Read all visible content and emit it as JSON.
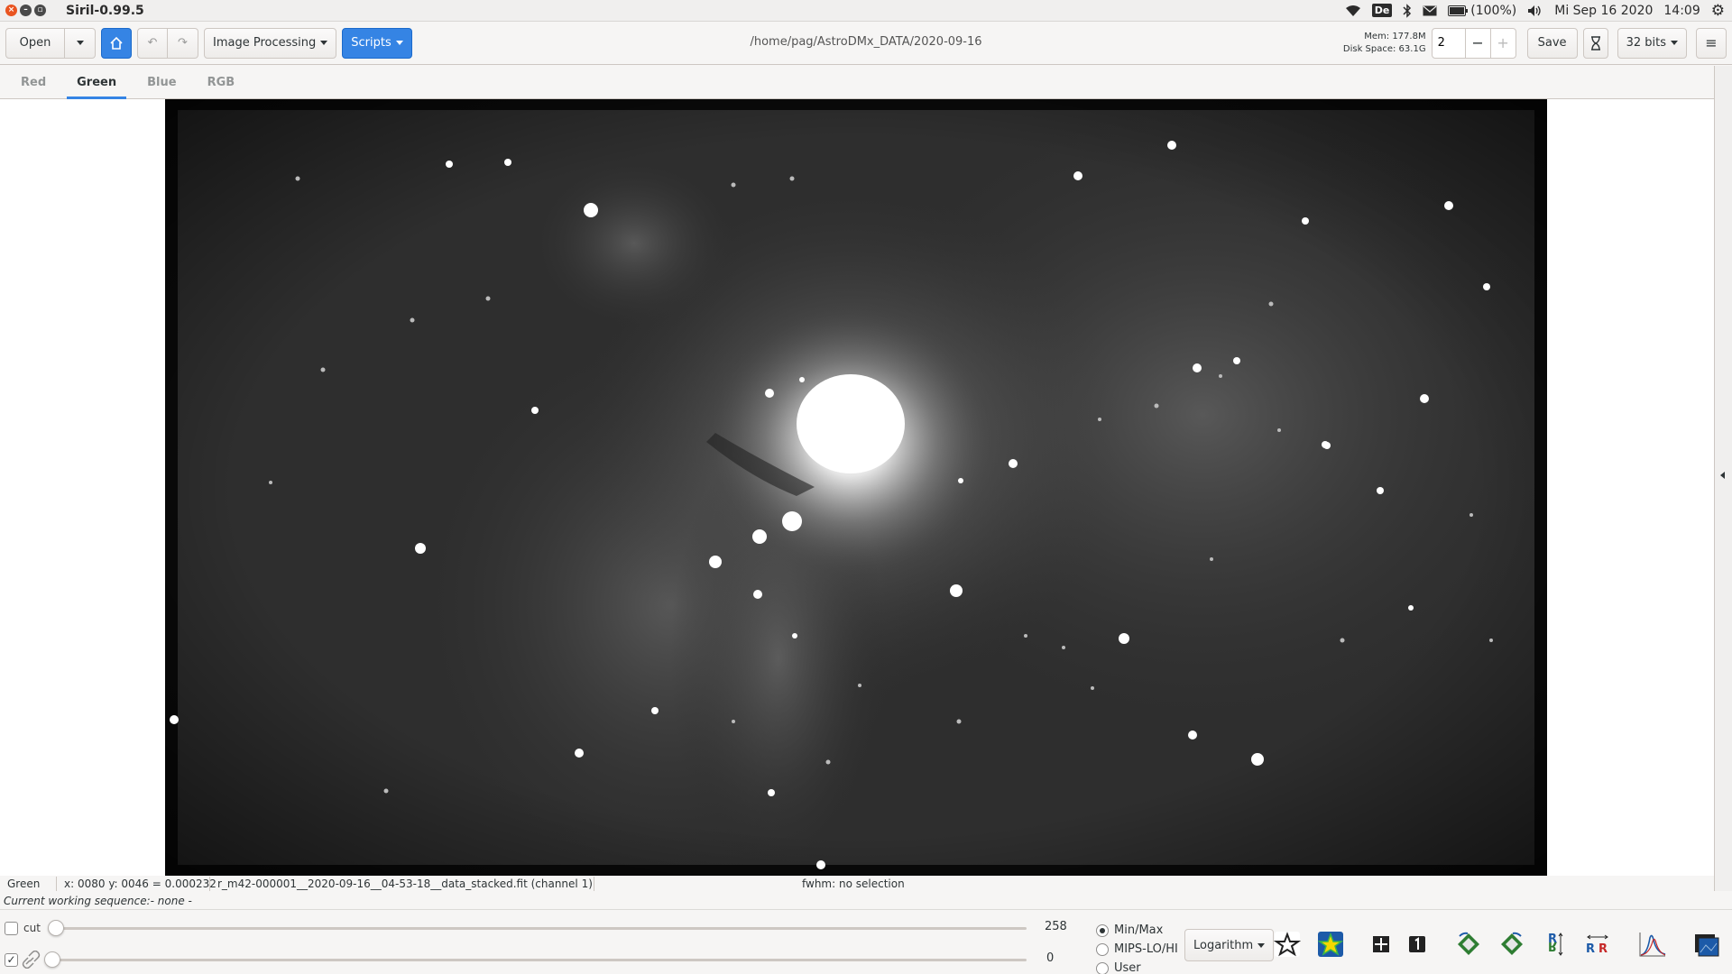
{
  "window": {
    "title": "Siril-0.99.5"
  },
  "system_tray": {
    "keyboard_layout": "De",
    "battery": "(100%)",
    "date": "Mi Sep 16 2020",
    "time": "14:09"
  },
  "toolbar": {
    "open_label": "Open",
    "image_processing_label": "Image Processing",
    "scripts_label": "Scripts",
    "path": "/home/pag/AstroDMx_DATA/2020-09-16",
    "mem": "Mem: 177.8M",
    "disk": "Disk Space: 63.1G",
    "threads_value": "2",
    "save_label": "Save",
    "bits_label": "32 bits"
  },
  "tabs": [
    {
      "label": "Red",
      "active": false
    },
    {
      "label": "Green",
      "active": true
    },
    {
      "label": "Blue",
      "active": false
    },
    {
      "label": "RGB",
      "active": false
    }
  ],
  "status": {
    "channel": "Green",
    "coords": "x: 0080 y: 0046 = 0.000232",
    "filename": "r_m42-000001__2020-09-16__04-53-18__data_stacked.fit (channel 1)",
    "fwhm": "fwhm: no selection",
    "sequence": "Current working sequence:- none -"
  },
  "display": {
    "cut_label": "cut",
    "high_value": "258",
    "low_value": "0",
    "high_fraction": 0.0,
    "low_fraction": 0.0,
    "radio_options": [
      "Min/Max",
      "MIPS-LO/HI",
      "User"
    ],
    "radio_selected": "Min/Max",
    "scale_mode": "Logarithm"
  }
}
